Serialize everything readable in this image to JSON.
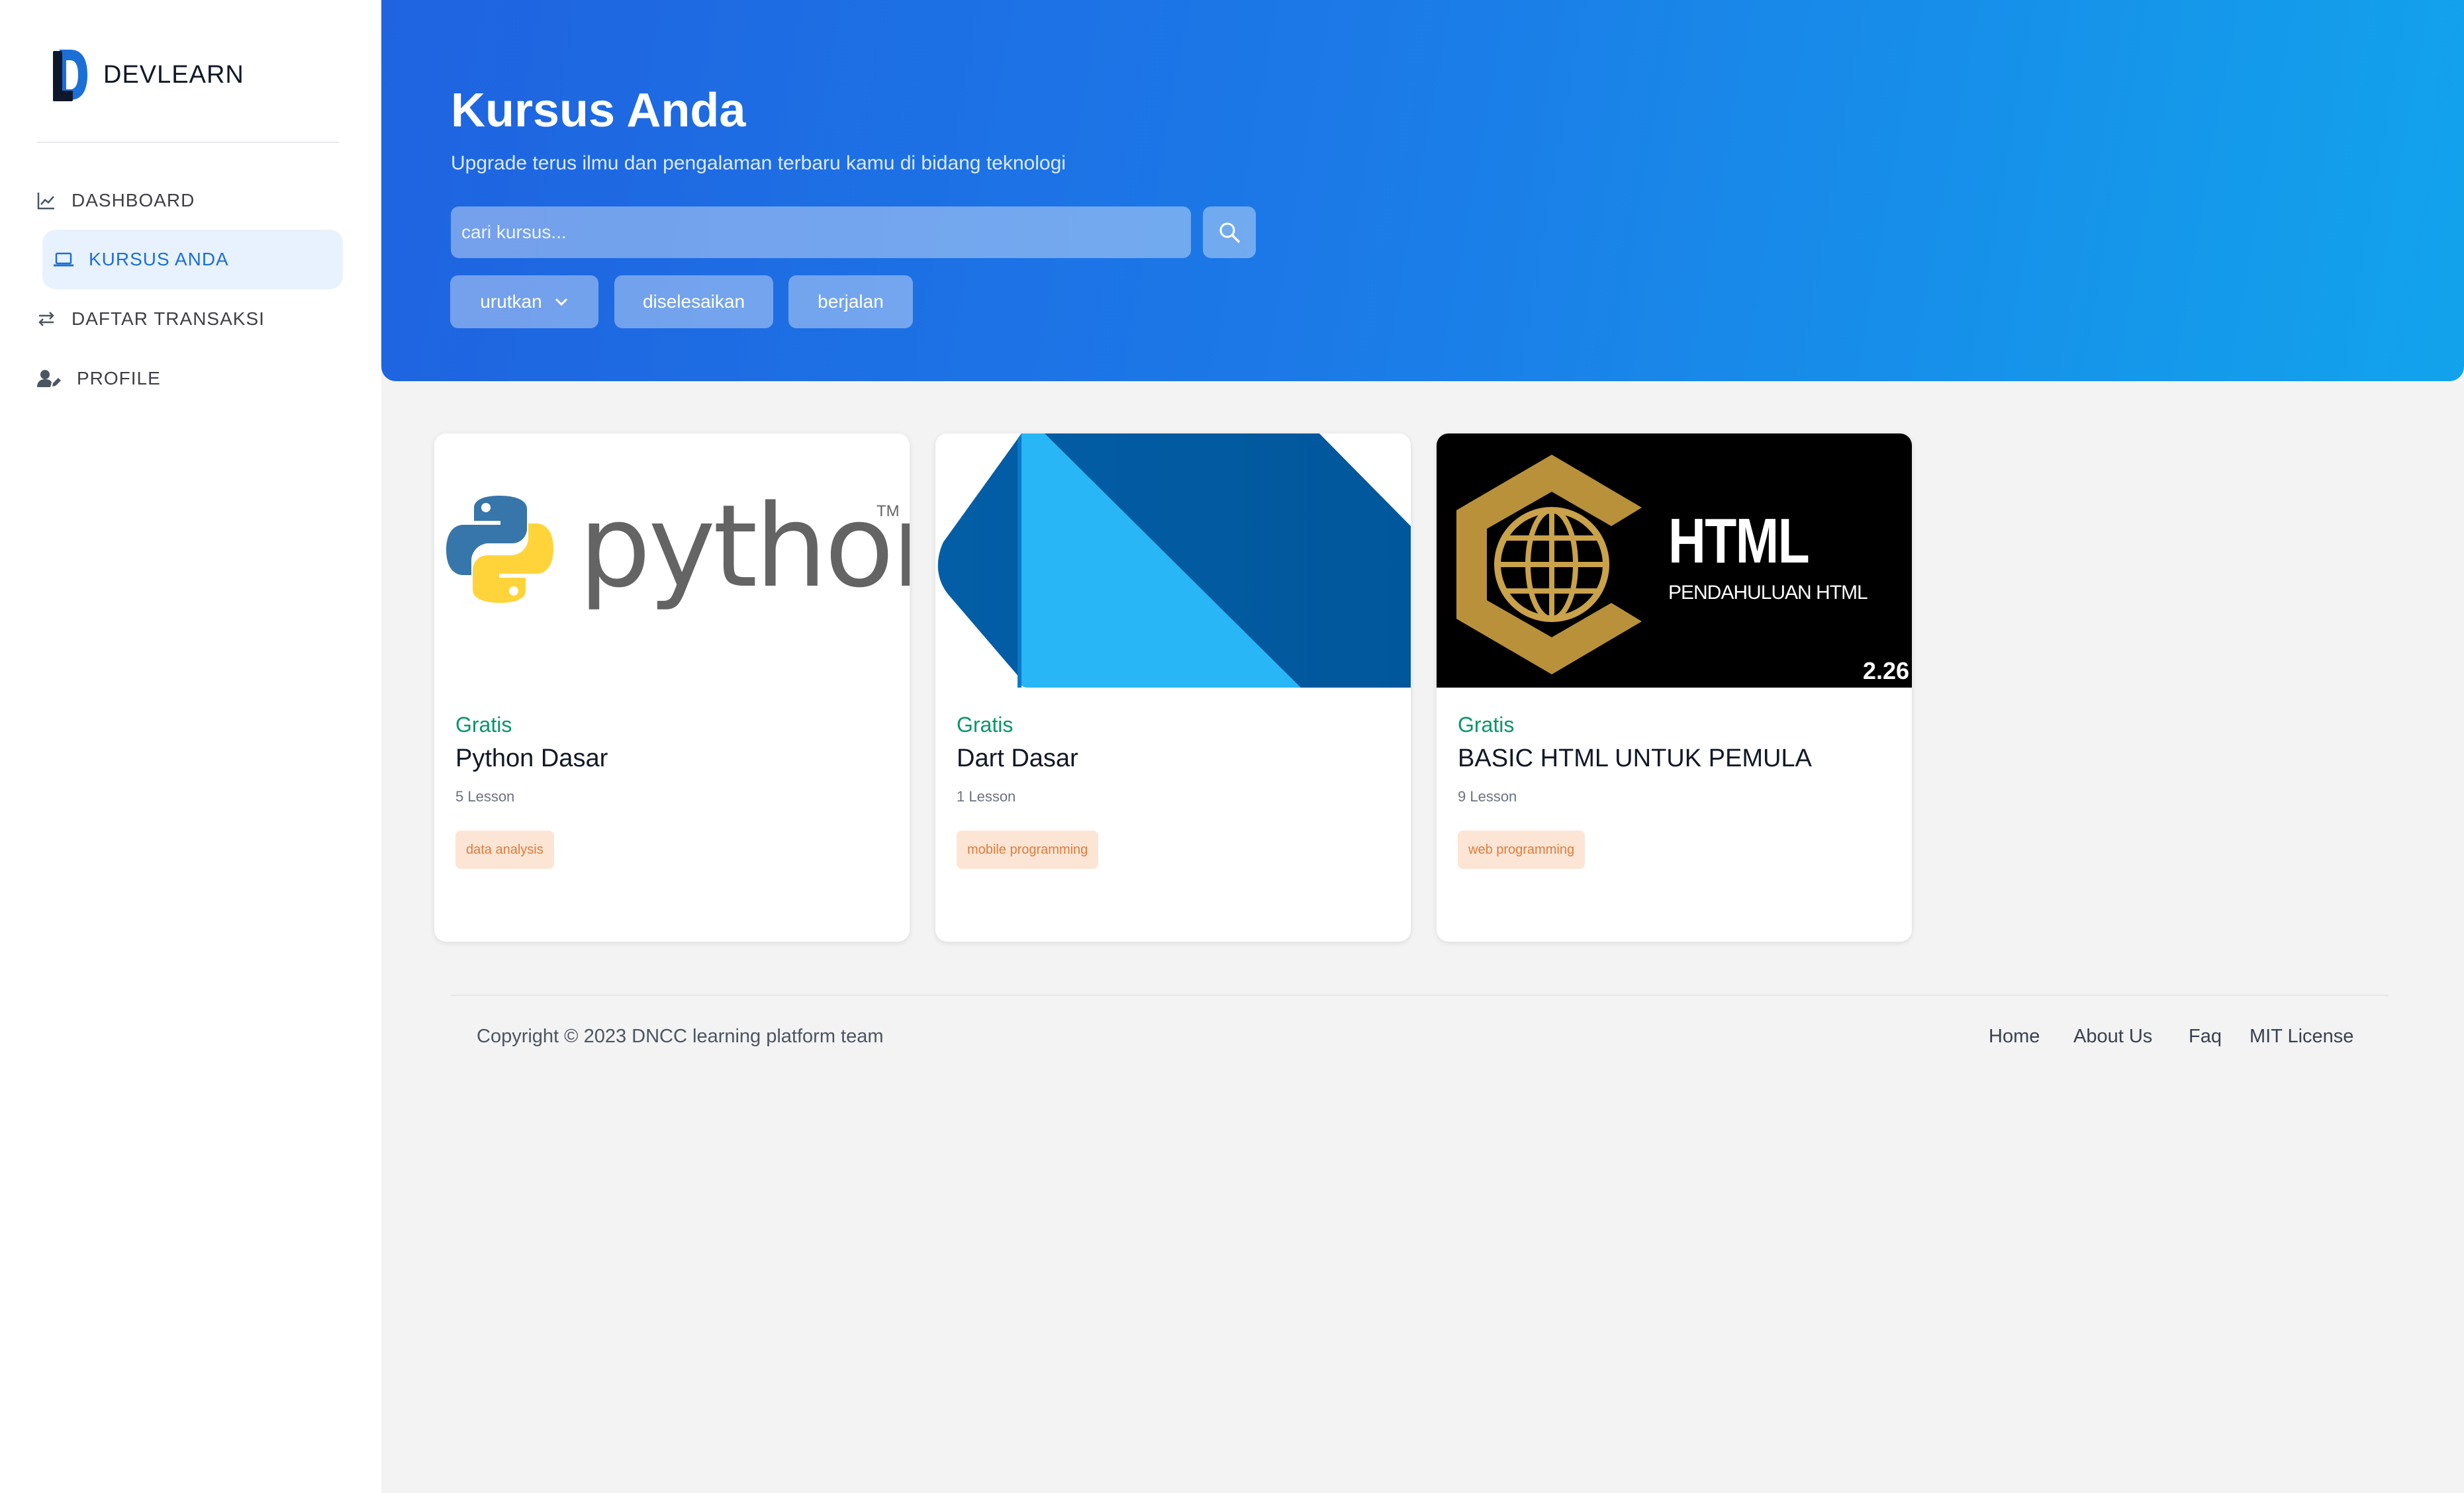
{
  "brand": {
    "name": "DEVLEARN"
  },
  "sidebar": {
    "items": [
      {
        "label": "DASHBOARD",
        "icon": "line-chart-icon"
      },
      {
        "label": "KURSUS ANDA",
        "icon": "laptop-icon",
        "active": true
      },
      {
        "label": "DAFTAR TRANSAKSI",
        "icon": "arrows-exchange-icon"
      },
      {
        "label": "PROFILE",
        "icon": "user-edit-icon"
      }
    ]
  },
  "hero": {
    "title": "Kursus Anda",
    "subtitle": "Upgrade terus ilmu dan pengalaman terbaru kamu di bidang teknologi",
    "search_placeholder": "cari kursus...",
    "filters": {
      "sort": "urutkan",
      "done": "diselesaikan",
      "ongoing": "berjalan"
    }
  },
  "courses": [
    {
      "price": "Gratis",
      "title": "Python Dasar",
      "lessons": "5 Lesson",
      "tag": "data analysis",
      "image_text": "python",
      "image_trademark": "TM"
    },
    {
      "price": "Gratis",
      "title": "Dart Dasar",
      "lessons": "1 Lesson",
      "tag": "mobile programming"
    },
    {
      "price": "Gratis",
      "title": "BASIC HTML UNTUK PEMULA",
      "lessons": "9 Lesson",
      "tag": "web programming",
      "image_title": "HTML",
      "image_subtitle": "PENDAHULUAN HTML",
      "image_badge": "2.26"
    }
  ],
  "footer": {
    "copyright": "Copyright © 2023 DNCC learning platform team",
    "links": [
      "Home",
      "About Us",
      "Faq",
      "MIT License"
    ]
  },
  "colors": {
    "accent": "#1d6fd8",
    "hero_start": "#1f63e0",
    "hero_end": "#12a3ec",
    "price_green": "#059669",
    "tag_bg": "#fde5d5",
    "tag_text": "#e07b39"
  }
}
